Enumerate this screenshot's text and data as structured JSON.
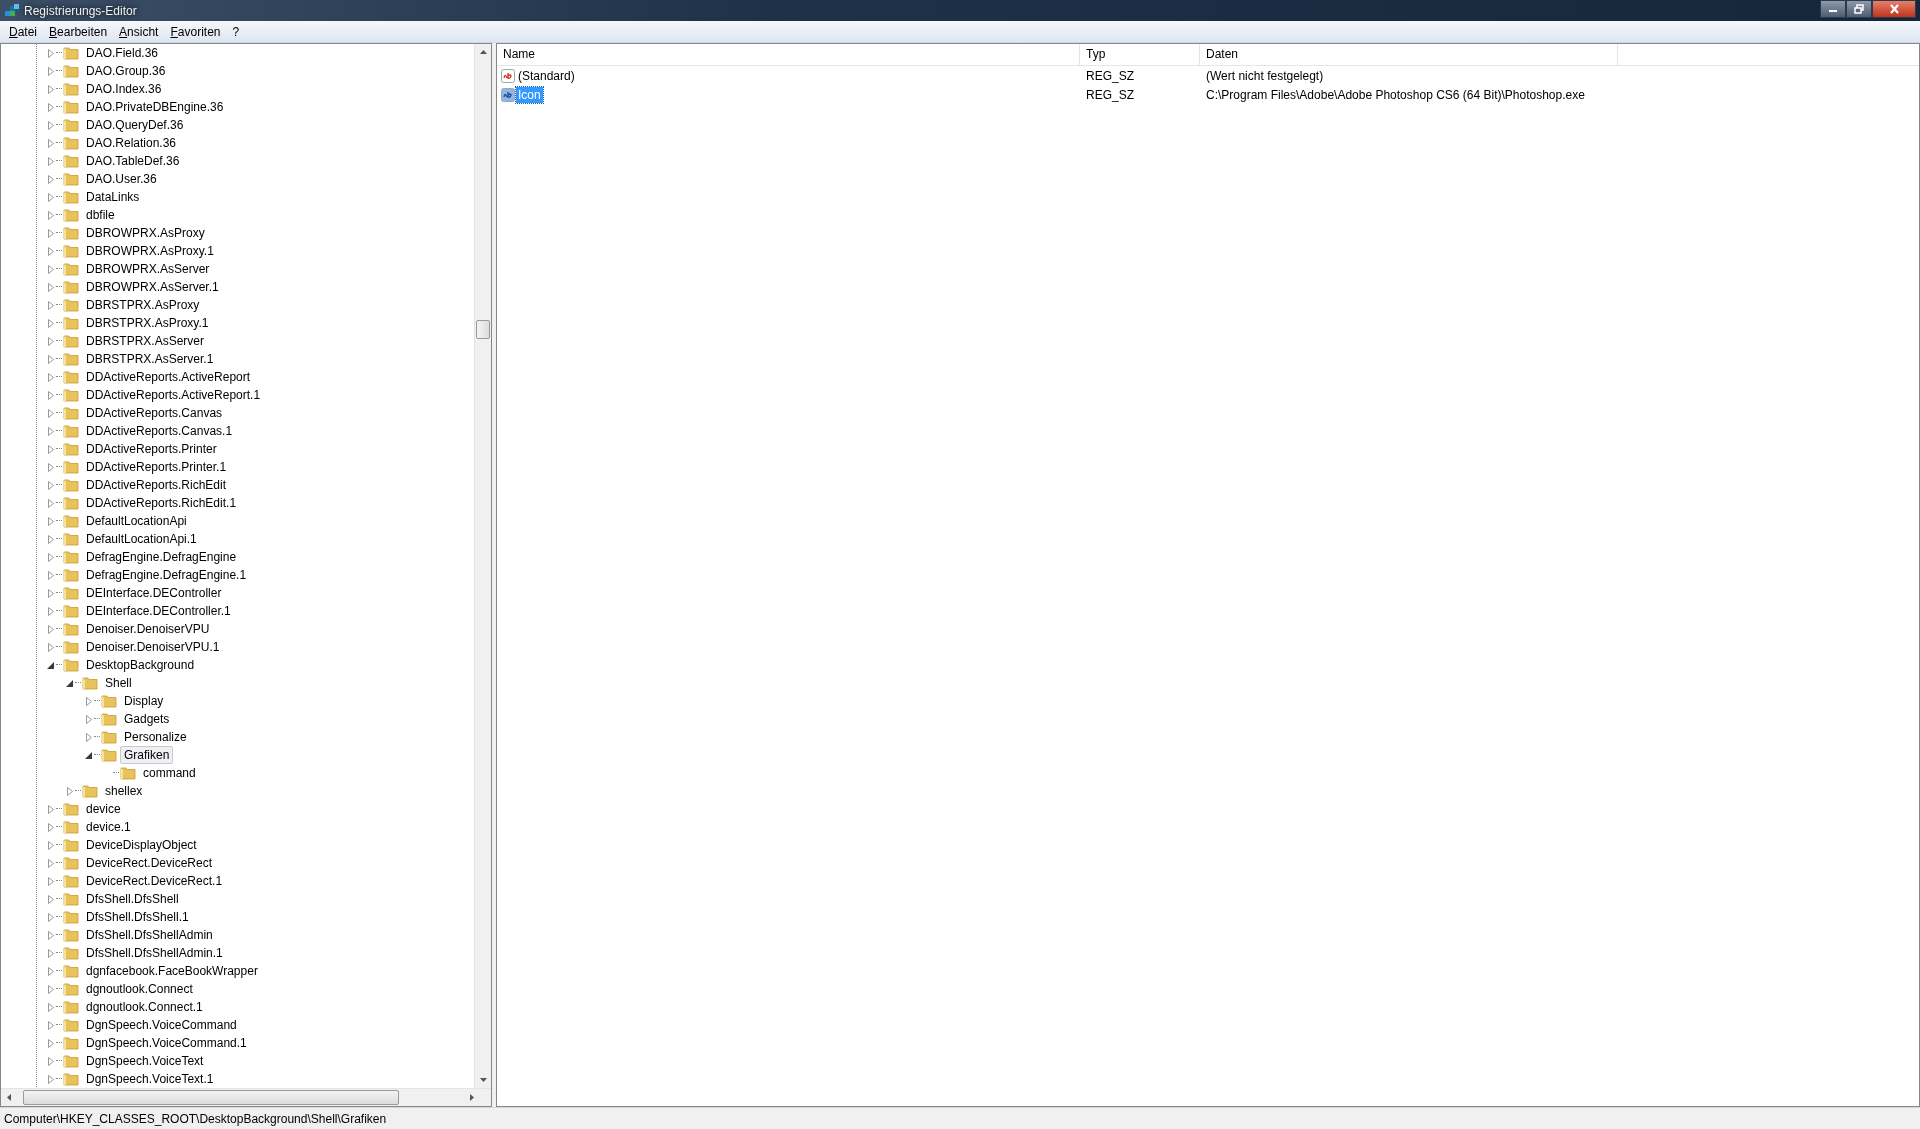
{
  "window": {
    "title": "Registrierungs-Editor"
  },
  "menu": [
    "Datei",
    "Bearbeiten",
    "Ansicht",
    "Favoriten",
    "?"
  ],
  "tree": [
    {
      "label": "DAO.Field.36",
      "expanded": false,
      "selected": false
    },
    {
      "label": "DAO.Group.36",
      "expanded": false,
      "selected": false
    },
    {
      "label": "DAO.Index.36",
      "expanded": false,
      "selected": false
    },
    {
      "label": "DAO.PrivateDBEngine.36",
      "expanded": false,
      "selected": false
    },
    {
      "label": "DAO.QueryDef.36",
      "expanded": false,
      "selected": false
    },
    {
      "label": "DAO.Relation.36",
      "expanded": false,
      "selected": false
    },
    {
      "label": "DAO.TableDef.36",
      "expanded": false,
      "selected": false
    },
    {
      "label": "DAO.User.36",
      "expanded": false,
      "selected": false
    },
    {
      "label": "DataLinks",
      "expanded": false,
      "selected": false
    },
    {
      "label": "dbfile",
      "expanded": false,
      "selected": false
    },
    {
      "label": "DBROWPRX.AsProxy",
      "expanded": false,
      "selected": false
    },
    {
      "label": "DBROWPRX.AsProxy.1",
      "expanded": false,
      "selected": false
    },
    {
      "label": "DBROWPRX.AsServer",
      "expanded": false,
      "selected": false
    },
    {
      "label": "DBROWPRX.AsServer.1",
      "expanded": false,
      "selected": false
    },
    {
      "label": "DBRSTPRX.AsProxy",
      "expanded": false,
      "selected": false
    },
    {
      "label": "DBRSTPRX.AsProxy.1",
      "expanded": false,
      "selected": false
    },
    {
      "label": "DBRSTPRX.AsServer",
      "expanded": false,
      "selected": false
    },
    {
      "label": "DBRSTPRX.AsServer.1",
      "expanded": false,
      "selected": false
    },
    {
      "label": "DDActiveReports.ActiveReport",
      "expanded": false,
      "selected": false
    },
    {
      "label": "DDActiveReports.ActiveReport.1",
      "expanded": false,
      "selected": false
    },
    {
      "label": "DDActiveReports.Canvas",
      "expanded": false,
      "selected": false
    },
    {
      "label": "DDActiveReports.Canvas.1",
      "expanded": false,
      "selected": false
    },
    {
      "label": "DDActiveReports.Printer",
      "expanded": false,
      "selected": false
    },
    {
      "label": "DDActiveReports.Printer.1",
      "expanded": false,
      "selected": false
    },
    {
      "label": "DDActiveReports.RichEdit",
      "expanded": false,
      "selected": false
    },
    {
      "label": "DDActiveReports.RichEdit.1",
      "expanded": false,
      "selected": false
    },
    {
      "label": "DefaultLocationApi",
      "expanded": false,
      "selected": false
    },
    {
      "label": "DefaultLocationApi.1",
      "expanded": false,
      "selected": false
    },
    {
      "label": "DefragEngine.DefragEngine",
      "expanded": false,
      "selected": false
    },
    {
      "label": "DefragEngine.DefragEngine.1",
      "expanded": false,
      "selected": false
    },
    {
      "label": "DEInterface.DEController",
      "expanded": false,
      "selected": false
    },
    {
      "label": "DEInterface.DEController.1",
      "expanded": false,
      "selected": false
    },
    {
      "label": "Denoiser.DenoiserVPU",
      "expanded": false,
      "selected": false
    },
    {
      "label": "Denoiser.DenoiserVPU.1",
      "expanded": false,
      "selected": false
    },
    {
      "label": "DesktopBackground",
      "expanded": true,
      "selected": false,
      "children": [
        {
          "label": "Shell",
          "expanded": true,
          "selected": false,
          "children": [
            {
              "label": "Display",
              "expanded": false,
              "selected": false
            },
            {
              "label": "Gadgets",
              "expanded": false,
              "selected": false
            },
            {
              "label": "Personalize",
              "expanded": false,
              "selected": false
            },
            {
              "label": "Grafiken",
              "expanded": true,
              "selected": true,
              "children": [
                {
                  "label": "command",
                  "expanded": false,
                  "selected": false,
                  "leaf": true
                }
              ]
            }
          ]
        },
        {
          "label": "shellex",
          "expanded": false,
          "selected": false
        }
      ]
    },
    {
      "label": "device",
      "expanded": false,
      "selected": false
    },
    {
      "label": "device.1",
      "expanded": false,
      "selected": false
    },
    {
      "label": "DeviceDisplayObject",
      "expanded": false,
      "selected": false
    },
    {
      "label": "DeviceRect.DeviceRect",
      "expanded": false,
      "selected": false
    },
    {
      "label": "DeviceRect.DeviceRect.1",
      "expanded": false,
      "selected": false
    },
    {
      "label": "DfsShell.DfsShell",
      "expanded": false,
      "selected": false
    },
    {
      "label": "DfsShell.DfsShell.1",
      "expanded": false,
      "selected": false
    },
    {
      "label": "DfsShell.DfsShellAdmin",
      "expanded": false,
      "selected": false
    },
    {
      "label": "DfsShell.DfsShellAdmin.1",
      "expanded": false,
      "selected": false
    },
    {
      "label": "dgnfacebook.FaceBookWrapper",
      "expanded": false,
      "selected": false
    },
    {
      "label": "dgnoutlook.Connect",
      "expanded": false,
      "selected": false
    },
    {
      "label": "dgnoutlook.Connect.1",
      "expanded": false,
      "selected": false
    },
    {
      "label": "DgnSpeech.VoiceCommand",
      "expanded": false,
      "selected": false
    },
    {
      "label": "DgnSpeech.VoiceCommand.1",
      "expanded": false,
      "selected": false
    },
    {
      "label": "DgnSpeech.VoiceText",
      "expanded": false,
      "selected": false
    },
    {
      "label": "DgnSpeech.VoiceText.1",
      "expanded": false,
      "selected": false
    }
  ],
  "values": {
    "columns": [
      "Name",
      "Typ",
      "Daten"
    ],
    "rows": [
      {
        "name": "(Standard)",
        "type": "REG_SZ",
        "data": "(Wert nicht festgelegt)",
        "selected": false
      },
      {
        "name": "Icon",
        "type": "REG_SZ",
        "data": "C:\\Program Files\\Adobe\\Adobe Photoshop CS6 (64 Bit)\\Photoshop.exe",
        "selected": true
      }
    ]
  },
  "status_bar": "Computer\\HKEY_CLASSES_ROOT\\DesktopBackground\\Shell\\Grafiken"
}
